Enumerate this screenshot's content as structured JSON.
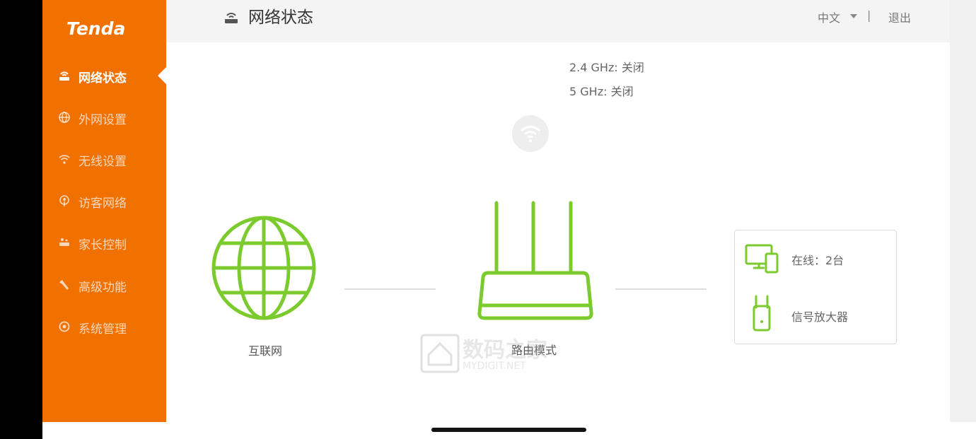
{
  "brand": {
    "logo_text": "Tenda",
    "accent_color": "#f07000",
    "status_color": "#7ccb2e"
  },
  "sidebar": {
    "items": [
      {
        "label": "网络状态",
        "icon": "router-icon",
        "active": true
      },
      {
        "label": "外网设置",
        "icon": "globe-icon",
        "active": false
      },
      {
        "label": "无线设置",
        "icon": "wifi-icon",
        "active": false
      },
      {
        "label": "访客网络",
        "icon": "guest-icon",
        "active": false
      },
      {
        "label": "家长控制",
        "icon": "parental-icon",
        "active": false
      },
      {
        "label": "高级功能",
        "icon": "wrench-icon",
        "active": false
      },
      {
        "label": "系统管理",
        "icon": "gear-icon",
        "active": false
      }
    ]
  },
  "header": {
    "title": "网络状态",
    "language": "中文",
    "separator": "|",
    "logout": "退出"
  },
  "wifi_status": {
    "band_24": "2.4 GHz: 关闭",
    "band_5": "5 GHz: 关闭"
  },
  "topology": {
    "internet_label": "互联网",
    "router_label": "路由模式"
  },
  "devices": {
    "online": "在线：2台",
    "extender": "信号放大器"
  },
  "watermark": {
    "text": "数码之家",
    "sub": "MYDIGIT.NET"
  }
}
